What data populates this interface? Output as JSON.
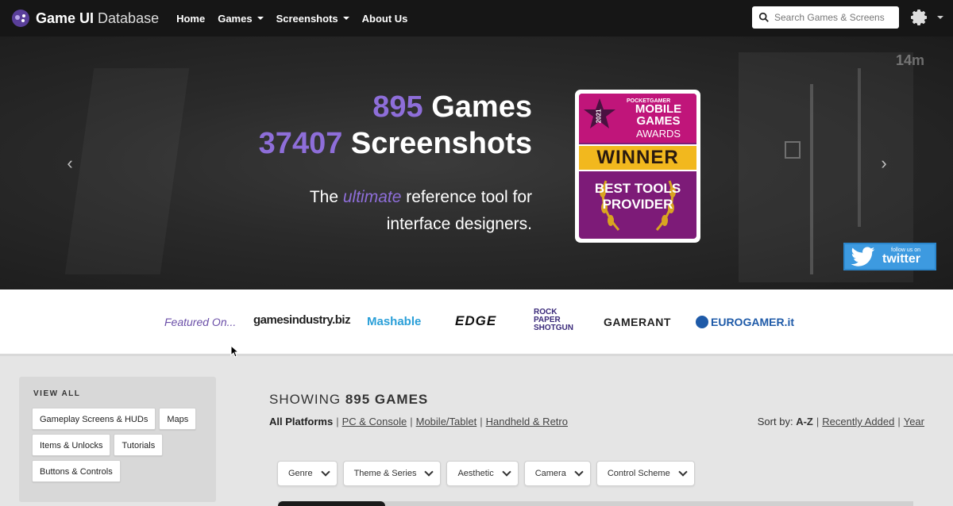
{
  "navbar": {
    "brand_bold": "Game UI",
    "brand_light": " Database",
    "links": [
      "Home",
      "Games",
      "Screenshots",
      "About Us"
    ],
    "search_placeholder": "Search Games & Screens"
  },
  "hero": {
    "games_count": "895",
    "games_label": " Games",
    "screens_count": "37407",
    "screens_label": " Screenshots",
    "tagline_pre": "The ",
    "tagline_em": "ultimate",
    "tagline_post": " reference tool for interface designers.",
    "bg_text": "14m",
    "award": {
      "brand": "POCKETGAMER",
      "title": "MOBILE GAMES",
      "subtitle": "AWARDS",
      "year": "2021",
      "winner": "WINNER",
      "category_line1": "BEST TOOLS",
      "category_line2": "PROVIDER"
    },
    "twitter_small": "follow us on",
    "twitter_big": "twitter"
  },
  "featured": {
    "label": "Featured On...",
    "logos": [
      "gamesindustry.biz",
      "Mashable",
      "EDGE",
      "ROCK PAPER SHOTGUN",
      "GAMERANT",
      "EUROGAMER.it"
    ]
  },
  "sidebar": {
    "title": "VIEW ALL",
    "tags": [
      "Gameplay Screens & HUDs",
      "Maps",
      "Items & Unlocks",
      "Tutorials",
      "Buttons & Controls"
    ]
  },
  "main": {
    "showing_prefix": "SHOWING ",
    "showing_count": "895 GAMES",
    "platforms": [
      "All Platforms",
      "PC & Console",
      "Mobile/Tablet",
      "Handheld & Retro"
    ],
    "sort_label": "Sort by: ",
    "sort_active": "A-Z",
    "sort_options": [
      "Recently Added",
      "Year"
    ],
    "filters": [
      "Genre",
      "Theme & Series",
      "Aesthetic",
      "Camera",
      "Control Scheme"
    ]
  },
  "colors": {
    "accent_purple": "#8e6ed9",
    "navbar_bg": "#161616",
    "twitter_blue": "#3d9ae0"
  }
}
